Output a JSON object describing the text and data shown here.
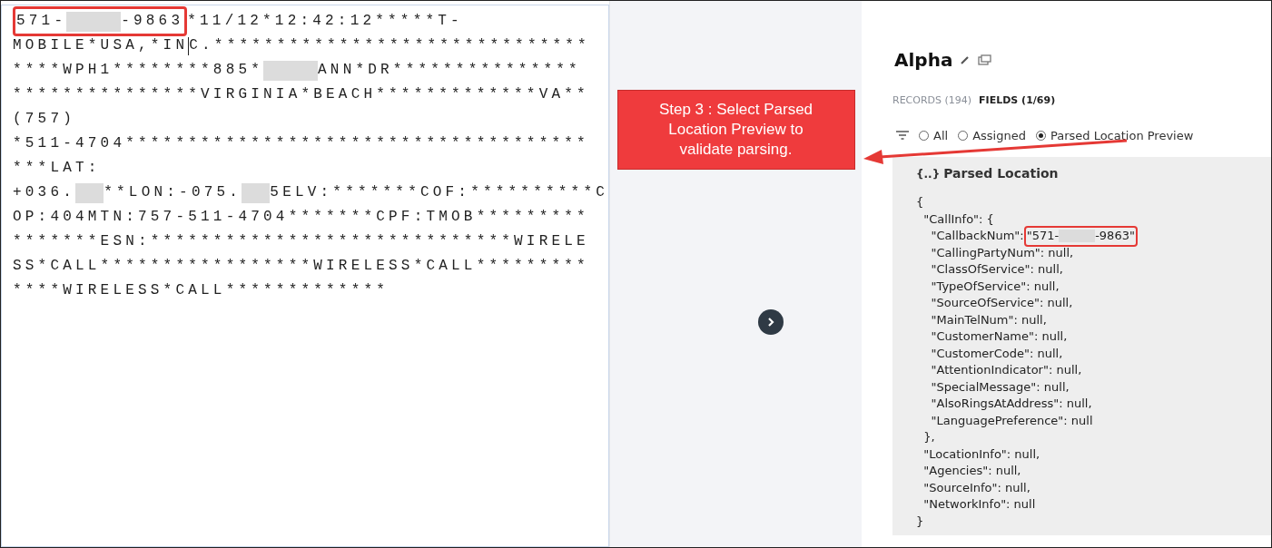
{
  "raw_text": {
    "lines": [
      [
        {
          "kind": "highlight",
          "parts": [
            {
              "kind": "text",
              "text": "571-"
            },
            {
              "kind": "redacted"
            },
            {
              "kind": "text",
              "text": "-9863"
            }
          ]
        },
        {
          "kind": "text",
          "text": "*11/12*12:42:12*****T-"
        }
      ],
      [
        {
          "kind": "text",
          "text": "MOBILE*USA,*IN"
        },
        {
          "kind": "cursor"
        },
        {
          "kind": "text",
          "text": "C.******************************"
        }
      ],
      [
        {
          "kind": "text",
          "text": "****WPH1********885*"
        },
        {
          "kind": "redacted"
        },
        {
          "kind": "text",
          "text": "ANN*DR***************"
        }
      ],
      [
        {
          "kind": "text",
          "text": "***************VIRGINIA*BEACH*************VA**"
        }
      ],
      [
        {
          "kind": "text",
          "text": "(757)"
        }
      ],
      [
        {
          "kind": "text",
          "text": "*511-4704*************************************"
        }
      ],
      [
        {
          "kind": "text",
          "text": "***LAT:"
        }
      ],
      [
        {
          "kind": "text",
          "text": "+036."
        },
        {
          "kind": "redacted"
        },
        {
          "kind": "text",
          "text": "**LON:-075."
        },
        {
          "kind": "redacted"
        },
        {
          "kind": "text",
          "text": "5ELV:*******COF:**********C"
        }
      ],
      [
        {
          "kind": "text",
          "text": "OP:404MTN:757-511-4704*******CPF:TMOB*********"
        }
      ],
      [
        {
          "kind": "text",
          "text": "*******ESN:*****************************WIRELE"
        }
      ],
      [
        {
          "kind": "text",
          "text": "SS*CALL*****************WIRELESS*CALL*********"
        }
      ],
      [
        {
          "kind": "text",
          "text": "****WIRELESS*CALL*************"
        }
      ]
    ]
  },
  "callout": {
    "text": "Step 3 : Select Parsed Location Preview to validate parsing."
  },
  "header": {
    "title": "Alpha"
  },
  "tabs": [
    {
      "label": "RECORDS (194)",
      "selected": false
    },
    {
      "label": "FIELDS (1/69)",
      "selected": true
    }
  ],
  "filters": [
    {
      "label": "All",
      "selected": false
    },
    {
      "label": "Assigned",
      "selected": false
    },
    {
      "label": "Parsed Location Preview",
      "selected": true
    }
  ],
  "preview": {
    "icon_text": "{..}",
    "title": "Parsed Location",
    "lines": [
      [
        {
          "kind": "text",
          "text": "{"
        }
      ],
      [
        {
          "kind": "text",
          "text": "  \"CallInfo\": {"
        }
      ],
      [
        {
          "kind": "text",
          "text": "    \"CallbackNum\":"
        },
        {
          "kind": "highlight",
          "parts": [
            {
              "kind": "text",
              "text": "\"571-"
            },
            {
              "kind": "redacted"
            },
            {
              "kind": "text",
              "text": "-9863\""
            }
          ]
        }
      ],
      [
        {
          "kind": "text",
          "text": "    \"CallingPartyNum\": null,"
        }
      ],
      [
        {
          "kind": "text",
          "text": "    \"ClassOfService\": null,"
        }
      ],
      [
        {
          "kind": "text",
          "text": "    \"TypeOfService\": null,"
        }
      ],
      [
        {
          "kind": "text",
          "text": "    \"SourceOfService\": null,"
        }
      ],
      [
        {
          "kind": "text",
          "text": "    \"MainTelNum\": null,"
        }
      ],
      [
        {
          "kind": "text",
          "text": "    \"CustomerName\": null,"
        }
      ],
      [
        {
          "kind": "text",
          "text": "    \"CustomerCode\": null,"
        }
      ],
      [
        {
          "kind": "text",
          "text": "    \"AttentionIndicator\": null,"
        }
      ],
      [
        {
          "kind": "text",
          "text": "    \"SpecialMessage\": null,"
        }
      ],
      [
        {
          "kind": "text",
          "text": "    \"AlsoRingsAtAddress\": null,"
        }
      ],
      [
        {
          "kind": "text",
          "text": "    \"LanguagePreference\": null"
        }
      ],
      [
        {
          "kind": "text",
          "text": "  },"
        }
      ],
      [
        {
          "kind": "text",
          "text": "  \"LocationInfo\": null,"
        }
      ],
      [
        {
          "kind": "text",
          "text": "  \"Agencies\": null,"
        }
      ],
      [
        {
          "kind": "text",
          "text": "  \"SourceInfo\": null,"
        }
      ],
      [
        {
          "kind": "text",
          "text": "  \"NetworkInfo\": null"
        }
      ],
      [
        {
          "kind": "text",
          "text": "}"
        }
      ]
    ]
  }
}
